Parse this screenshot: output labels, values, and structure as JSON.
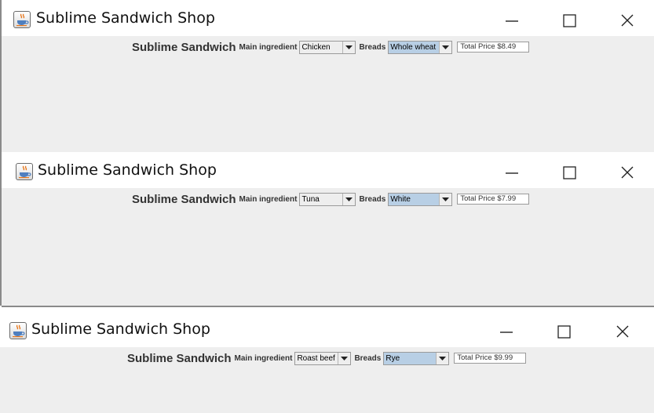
{
  "windows": [
    {
      "title": "Sublime Sandwich Shop",
      "heading": "Sublime Sandwich",
      "main_label": "Main ingredient",
      "main_value": "Chicken",
      "breads_label": "Breads",
      "breads_value": "Whole wheat",
      "price_text": "Total Price $8.49"
    },
    {
      "title": "Sublime Sandwich Shop",
      "heading": "Sublime Sandwich",
      "main_label": "Main ingredient",
      "main_value": "Tuna",
      "breads_label": "Breads",
      "breads_value": "White",
      "price_text": "Total Price $7.99"
    },
    {
      "title": "Sublime Sandwich Shop",
      "heading": "Sublime Sandwich",
      "main_label": "Main ingredient",
      "main_value": "Roast beef",
      "breads_label": "Breads",
      "breads_value": "Rye",
      "price_text": "Total Price $9.99"
    }
  ],
  "icons": {
    "app": "java-coffee-cup-icon",
    "minimize": "minimize-icon",
    "maximize": "maximize-icon",
    "close": "close-icon",
    "dropdown": "chevron-down-icon"
  },
  "colors": {
    "content_bg": "#eeeeee",
    "selection": "#b8cfe5",
    "text": "#333333"
  }
}
